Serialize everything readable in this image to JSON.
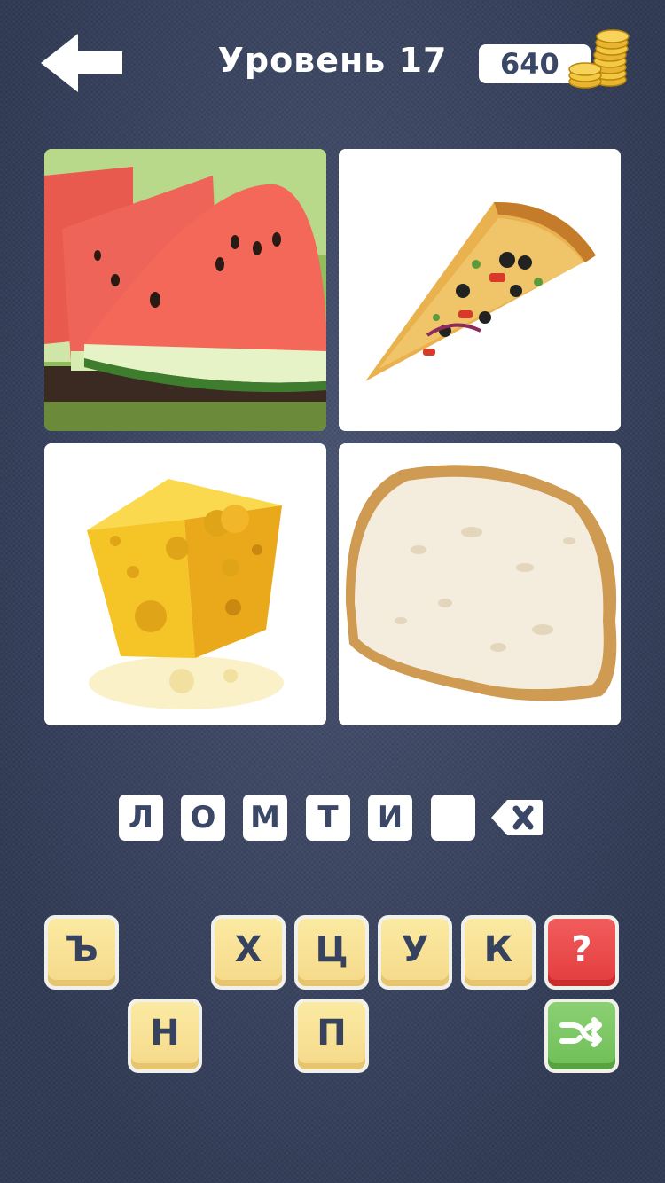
{
  "header": {
    "title": "Уровень 17",
    "coins": "640"
  },
  "puzzle": {
    "pictures": [
      {
        "subject": "watermelon slices"
      },
      {
        "subject": "pizza slice"
      },
      {
        "subject": "cheese wedge"
      },
      {
        "subject": "bread slice"
      }
    ],
    "answer_slots": [
      "Л",
      "О",
      "М",
      "Т",
      "И",
      ""
    ]
  },
  "keyboard": {
    "row1": [
      "Ъ",
      "Х",
      "Ц",
      "У",
      "К"
    ],
    "row2": [
      "Н",
      "П"
    ],
    "hint_label": "?"
  },
  "icons": {
    "back": "arrow-left-icon",
    "coins": "coin-stack-icon",
    "erase": "backspace-icon",
    "hint": "question-icon",
    "shuffle": "shuffle-icon"
  },
  "colors": {
    "background": "#3b4767",
    "key_face": "#f5d98a",
    "hint_red": "#e23d3d",
    "shuffle_green": "#6fbe56"
  }
}
